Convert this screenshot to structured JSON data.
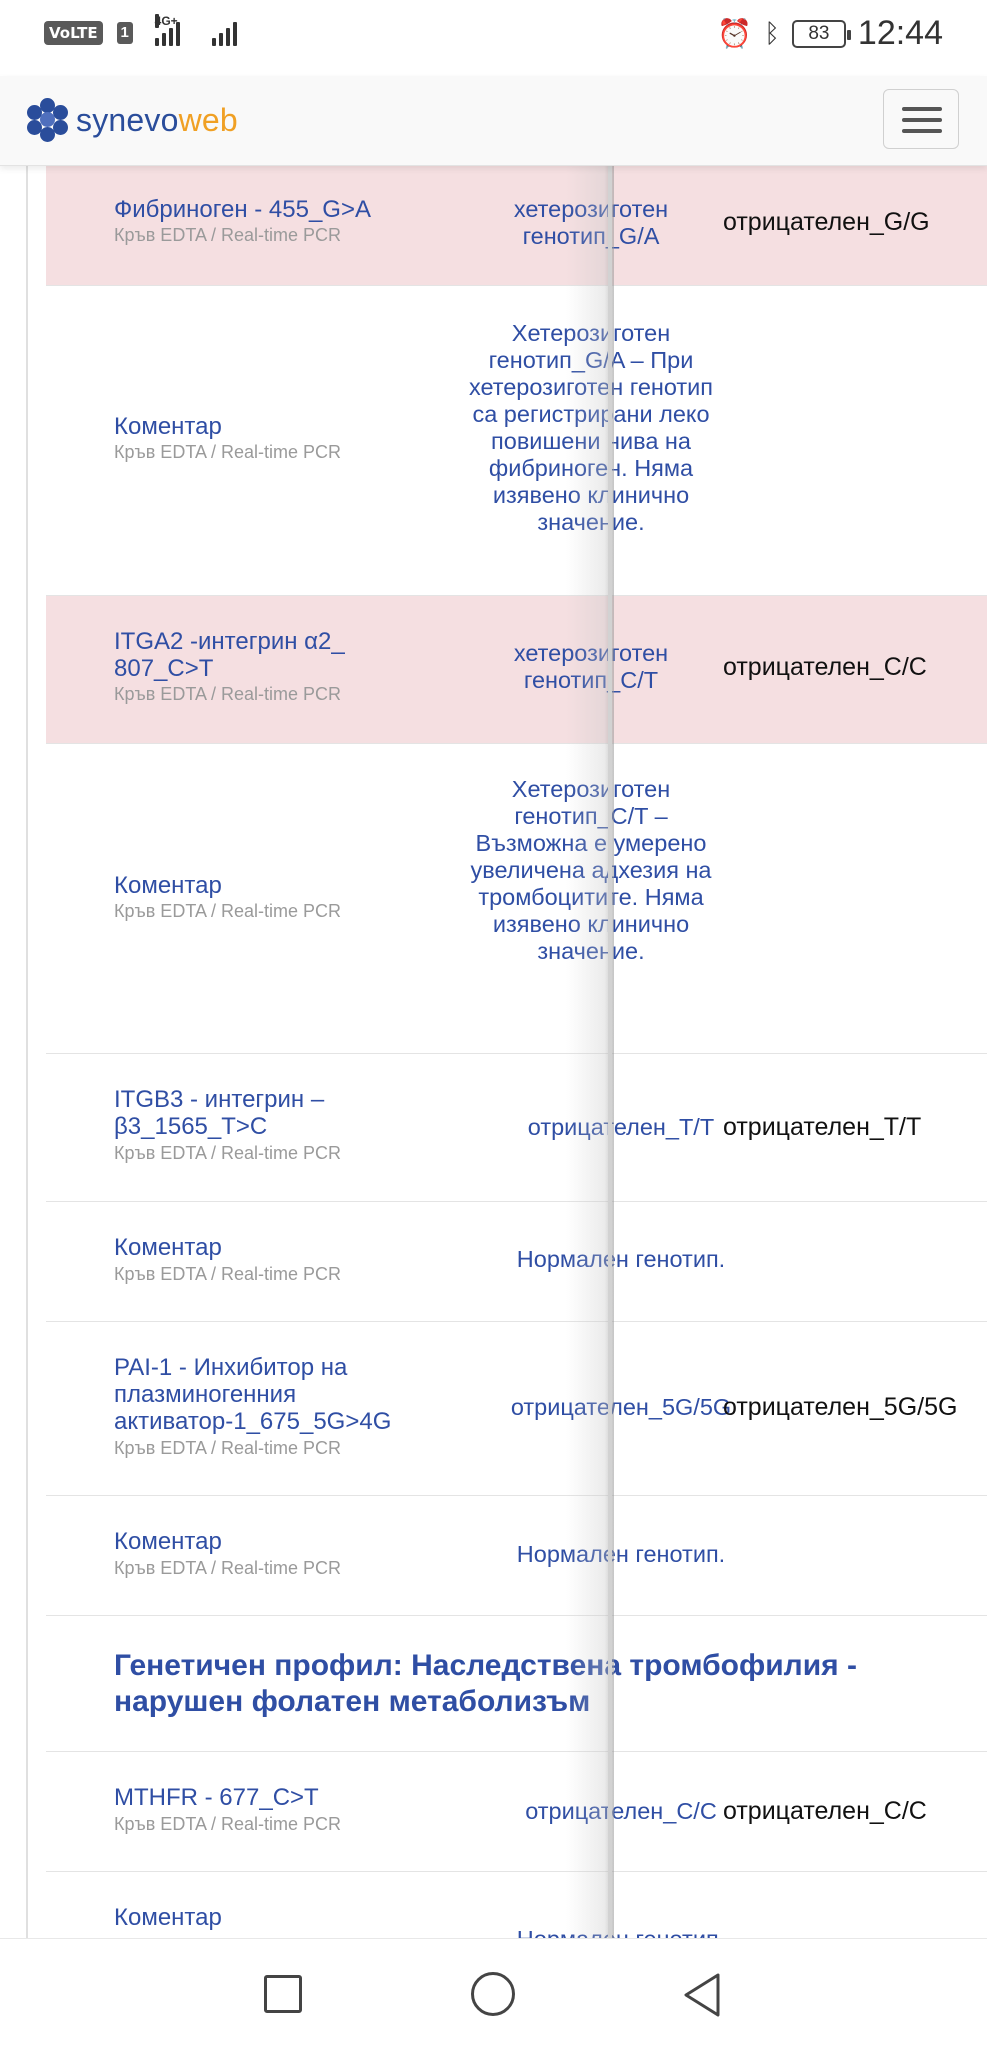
{
  "status_bar": {
    "volte": "VoLTE",
    "sim": "1",
    "network": "4G+",
    "battery": "83",
    "time": "12:44",
    "icons": [
      "alarm-icon",
      "bluetooth-icon"
    ]
  },
  "header": {
    "logo_main": "synevo",
    "logo_accent": "web",
    "brand_color": "#2a4d9b",
    "accent_color": "#f0a024",
    "menu_icon": "hamburger-icon"
  },
  "rows": [
    {
      "name": "Фибриноген - 455_G>A",
      "meta": "Кръв EDTA / Real-time PCR",
      "result": "хетерозиготен генотип_G/A",
      "ref": "отрицателен_G/G",
      "highlight": true
    },
    {
      "name": "Коментар",
      "meta": "Кръв EDTA / Real-time PCR",
      "result": "Хетерозиготен генотип_G/A – При хетерозиготен генотип са регистрирани леко повишени нива на фибриноген. Няма изявено клинично значение.",
      "ref": "",
      "highlight": false
    },
    {
      "name": "ITGA2 -интегрин α2_ 807_C>T",
      "meta": "Кръв EDTA / Real-time PCR",
      "result": "хетерозиготен генотип_C/T",
      "ref": "отрицателен_C/C",
      "highlight": true
    },
    {
      "name": "Коментар",
      "meta": "Кръв EDTA / Real-time PCR",
      "result": "Хетерозиготен генотип_C/T – Възможна е умерено увеличена адхезия на тромбоцитите. Няма изявено клинично значение.",
      "ref": "",
      "highlight": false
    },
    {
      "name": "ITGB3 - интегрин – β3_1565_T>C",
      "meta": "Кръв EDTA / Real-time PCR",
      "result": "отрицателен_T/T",
      "ref": "отрицателен_T/T",
      "highlight": false
    },
    {
      "name": "Коментар",
      "meta": "Кръв EDTA / Real-time PCR",
      "result": "Нормален генотип.",
      "ref": "",
      "highlight": false
    },
    {
      "name": "PAI-1 - Инхибитор на плазминогенния активатор-1_675_5G>4G",
      "meta": "Кръв EDTA / Real-time PCR",
      "result": "отрицателен_5G/5G",
      "ref": "отрицателен_5G/5G",
      "highlight": false
    },
    {
      "name": "Коментар",
      "meta": "Кръв EDTA / Real-time PCR",
      "result": "Нормален генотип.",
      "ref": "",
      "highlight": false
    }
  ],
  "section": {
    "title": "Генетичен профил: Наследствена тромбофилия - нарушен фолатен метаболизъм"
  },
  "rows2": [
    {
      "name": "MTHFR - 677_C>T",
      "meta": "Кръв EDTA / Real-time PCR",
      "result": "отрицателен_C/C",
      "ref": "отрицателен_C/C",
      "highlight": false
    },
    {
      "name": "Коментар",
      "meta": "",
      "result": "Нормален генотип.",
      "ref": "",
      "highlight": false
    }
  ],
  "navbar": {
    "icons": [
      "recent-apps-icon",
      "home-icon",
      "back-icon"
    ]
  }
}
